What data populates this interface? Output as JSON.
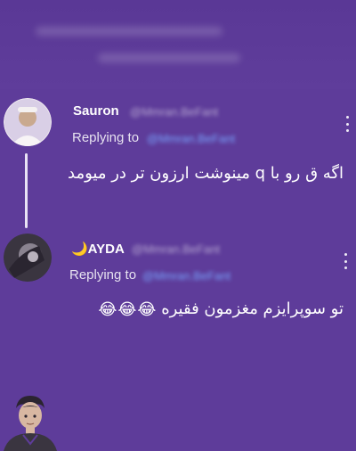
{
  "reply_prefix": "Replying to",
  "tweets": [
    {
      "display_name": "Sauron",
      "handle": "@Mmran.BeFant",
      "reply_handle": "@Mmran.BeFant",
      "text": "اگه ق رو با q مینوشت ارزون تر در میومد",
      "avatar_icon": "profile-photo-icon"
    },
    {
      "display_name": "🌙AYDA",
      "handle": "@Mmran.BeFant",
      "reply_handle": "@Mmran.BeFant",
      "text": "تو سوپرایزم مغزمون فقیره",
      "emoji": [
        "😂",
        "😂",
        "😂"
      ],
      "avatar_icon": "profile-photo-icon"
    }
  ],
  "more_icon": "more-options-icon",
  "bottom_avatar_icon": "illustrated-avatar-icon",
  "colors": {
    "background": "#5e3c9a",
    "thread_line": "#e9e3f5",
    "link": "#79a6ff"
  }
}
